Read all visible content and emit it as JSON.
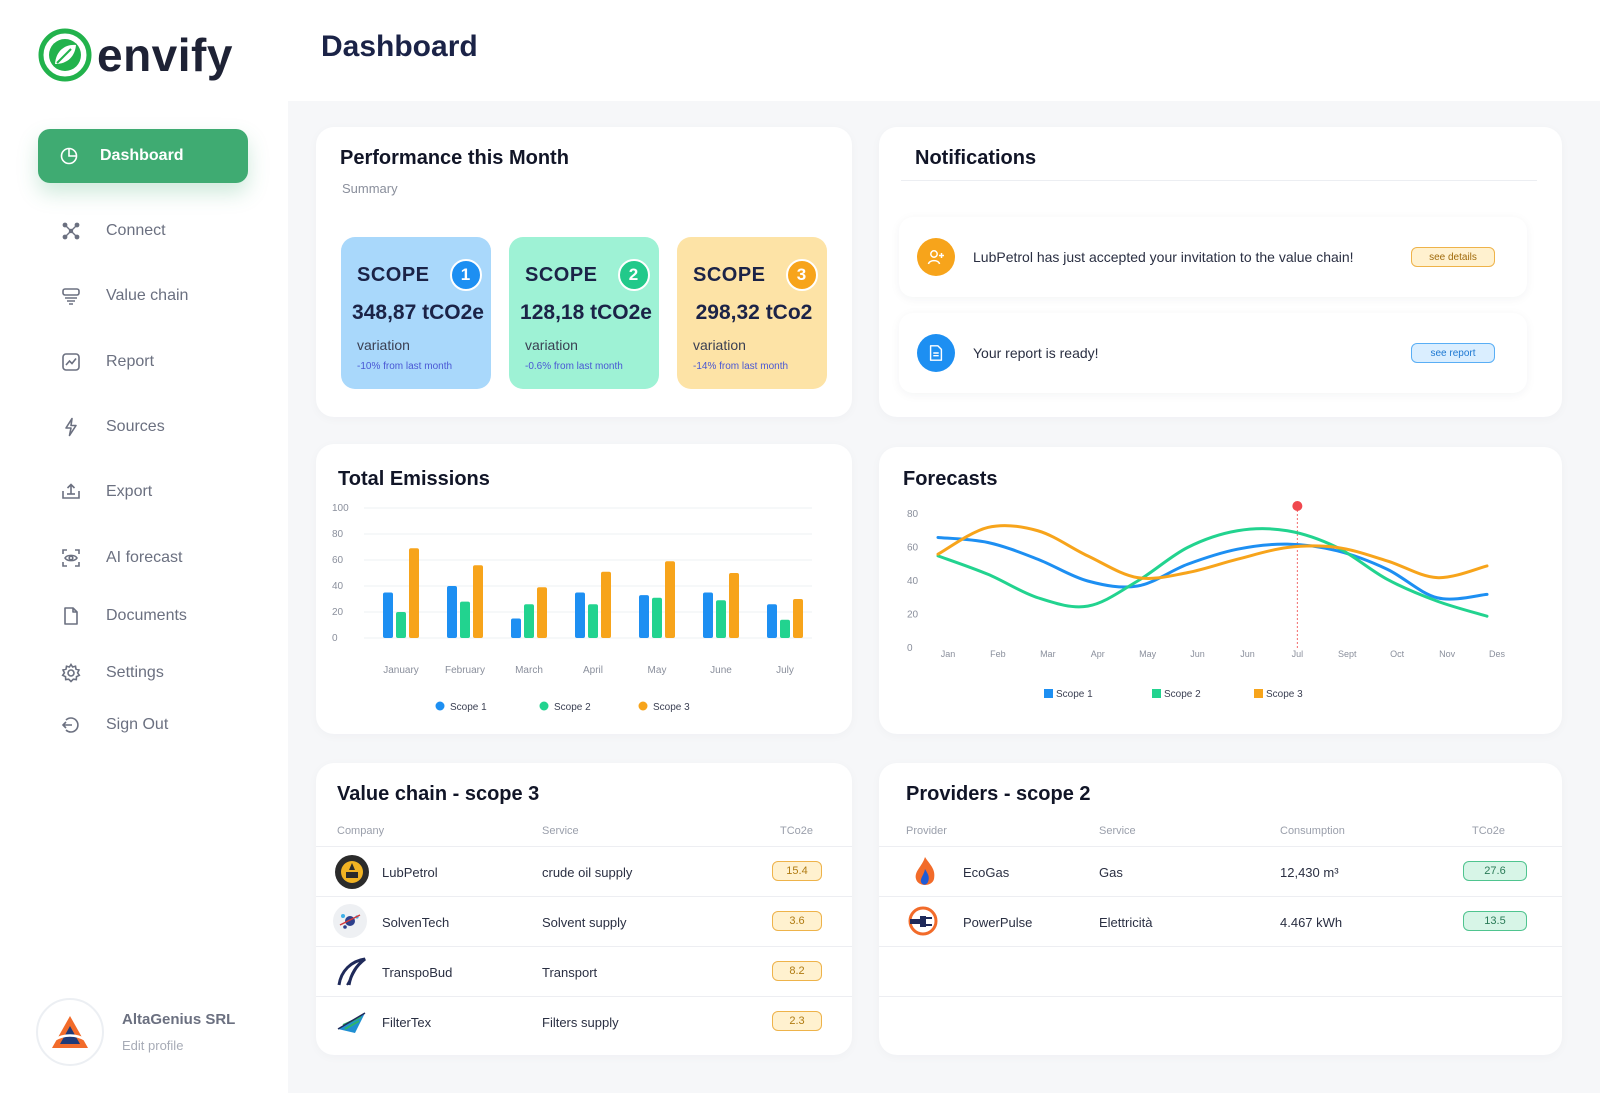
{
  "app": {
    "name": "envify",
    "brand_color": "#3fab72"
  },
  "sidebar": {
    "active": {
      "label": "Dashboard",
      "icon": "pie-chart-icon"
    },
    "items": [
      {
        "label": "Connect",
        "icon": "nodes-icon"
      },
      {
        "label": "Value chain",
        "icon": "stack-icon"
      },
      {
        "label": "Report",
        "icon": "line-chart-icon"
      },
      {
        "label": "Sources",
        "icon": "bolt-icon"
      },
      {
        "label": "Export",
        "icon": "export-icon"
      },
      {
        "label": "AI forecast",
        "icon": "eye-scan-icon"
      },
      {
        "label": "Documents",
        "icon": "document-icon"
      },
      {
        "label": "Settings",
        "icon": "gear-icon"
      },
      {
        "label": "Sign Out",
        "icon": "sign-out-icon"
      }
    ],
    "profile": {
      "name": "AltaGenius SRL",
      "edit": "Edit profile"
    }
  },
  "header": {
    "title": "Dashboard"
  },
  "performance": {
    "title": "Performance this Month",
    "subtitle": "Summary",
    "scopes": [
      {
        "label": "SCOPE",
        "number": "1",
        "value": "348,87 tCO2e",
        "variation_label": "variation",
        "variation": "-10% from last month",
        "bg": "#a9d8fb",
        "num_color": "#1d8ff2"
      },
      {
        "label": "SCOPE",
        "number": "2",
        "value": "128,18 tCO2e",
        "variation_label": "variation",
        "variation": "-0.6% from last month",
        "bg": "#9ef2d5",
        "num_color": "#22c98a"
      },
      {
        "label": "SCOPE",
        "number": "3",
        "value": "298,32 tCo2",
        "variation_label": "variation",
        "variation": "-14% from last month",
        "bg": "#fde3a6",
        "num_color": "#f7a41b"
      }
    ]
  },
  "notifications": {
    "title": "Notifications",
    "items": [
      {
        "text": "LubPetrol has just accepted your invitation to the value chain!",
        "button": "see details",
        "icon": "user-add-icon",
        "color": "#f7a41b"
      },
      {
        "text": "Your report is ready!",
        "button": "see report",
        "icon": "document-icon",
        "color": "#1d8ff2"
      }
    ]
  },
  "total_emissions": {
    "title": "Total Emissions",
    "chart_data": {
      "type": "bar",
      "categories": [
        "January",
        "February",
        "March",
        "April",
        "May",
        "June",
        "July"
      ],
      "series": [
        {
          "name": "Scope 1",
          "color": "#1d8ff2",
          "values": [
            35,
            40,
            15,
            35,
            33,
            35,
            26
          ]
        },
        {
          "name": "Scope 2",
          "color": "#22d38f",
          "values": [
            20,
            28,
            26,
            26,
            31,
            29,
            14
          ]
        },
        {
          "name": "Scope 3",
          "color": "#f7a41b",
          "values": [
            69,
            56,
            39,
            51,
            59,
            50,
            30
          ]
        }
      ],
      "yticks": [
        "0",
        "20",
        "40",
        "60",
        "80",
        "100"
      ],
      "ylim": [
        0,
        100
      ],
      "grid": true,
      "legend": "bottom"
    }
  },
  "forecasts": {
    "title": "Forecasts",
    "chart_data": {
      "type": "line",
      "x": [
        "Jan",
        "Feb",
        "Mar",
        "Apr",
        "May",
        "Jun",
        "Jun",
        "Jul",
        "Sept",
        "Oct",
        "Nov",
        "Des"
      ],
      "series": [
        {
          "name": "Scope 1",
          "color": "#1d8ff2",
          "values": [
            66,
            63,
            53,
            40,
            37,
            50,
            59,
            62,
            58,
            47,
            30,
            32
          ]
        },
        {
          "name": "Scope 2",
          "color": "#22d38f",
          "values": [
            55,
            44,
            30,
            25,
            40,
            60,
            70,
            70,
            60,
            41,
            28,
            19
          ]
        },
        {
          "name": "Scope 3",
          "color": "#f7a41b",
          "values": [
            56,
            72,
            70,
            55,
            42,
            45,
            53,
            60,
            60,
            52,
            42,
            49
          ]
        }
      ],
      "yticks": [
        "0",
        "20",
        "40",
        "60",
        "80"
      ],
      "ylim": [
        0,
        80
      ],
      "marker_x": "Jul",
      "legend": "bottom"
    }
  },
  "value_chain": {
    "title": "Value chain - scope 3",
    "columns": [
      "Company",
      "Service",
      "TCo2e"
    ],
    "rows": [
      {
        "company": "LubPetrol",
        "service": "crude oil supply",
        "tco2e": "15.4",
        "logo": "lubpetrol-logo"
      },
      {
        "company": "SolvenTech",
        "service": "Solvent supply",
        "tco2e": "3.6",
        "logo": "solventech-logo"
      },
      {
        "company": "TranspoBud",
        "service": "Transport",
        "tco2e": "8.2",
        "logo": "transpobud-logo"
      },
      {
        "company": "FilterTex",
        "service": "Filters supply",
        "tco2e": "2.3",
        "logo": "filtertex-logo"
      }
    ]
  },
  "providers": {
    "title": "Providers - scope 2",
    "columns": [
      "Provider",
      "Service",
      "Consumption",
      "TCo2e"
    ],
    "rows": [
      {
        "provider": "EcoGas",
        "service": "Gas",
        "consumption": "12,430 m³",
        "tco2e": "27.6",
        "logo": "flame-logo"
      },
      {
        "provider": "PowerPulse",
        "service": "Elettricità",
        "consumption": "4.467 kWh",
        "tco2e": "13.5",
        "logo": "plug-logo"
      }
    ]
  }
}
